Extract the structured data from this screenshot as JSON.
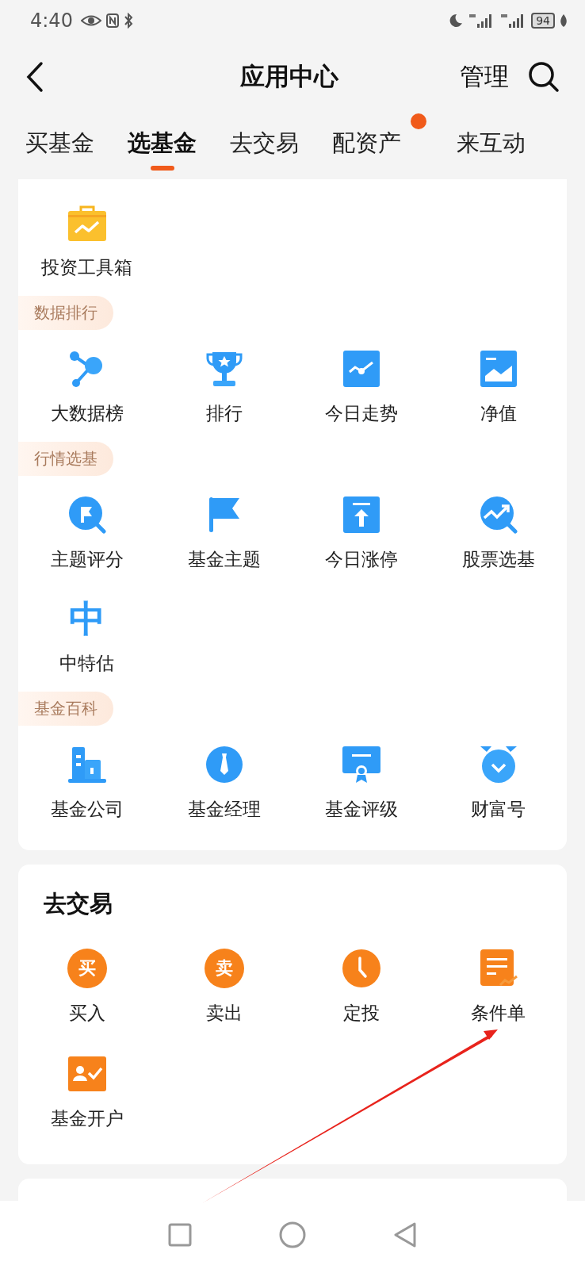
{
  "status_bar": {
    "time": "4:40",
    "battery": "94"
  },
  "header": {
    "title": "应用中心",
    "action": "管理"
  },
  "tabs": [
    {
      "label": "买基金",
      "selected": false,
      "dot": false
    },
    {
      "label": "选基金",
      "selected": true,
      "dot": false
    },
    {
      "label": "去交易",
      "selected": false,
      "dot": false
    },
    {
      "label": "配资产",
      "selected": false,
      "dot": true
    },
    {
      "label": "来互动",
      "selected": false,
      "dot": false
    }
  ],
  "select_card": {
    "sections": [
      {
        "items": [
          {
            "label": "投资工具箱"
          }
        ]
      },
      {
        "tag": "数据排行",
        "items": [
          {
            "label": "大数据榜"
          },
          {
            "label": "排行"
          },
          {
            "label": "今日走势"
          },
          {
            "label": "净值"
          }
        ]
      },
      {
        "tag": "行情选基",
        "items": [
          {
            "label": "主题评分"
          },
          {
            "label": "基金主题"
          },
          {
            "label": "今日涨停"
          },
          {
            "label": "股票选基"
          },
          {
            "label": "中特估",
            "glyph": "中"
          }
        ]
      },
      {
        "tag": "基金百科",
        "items": [
          {
            "label": "基金公司"
          },
          {
            "label": "基金经理"
          },
          {
            "label": "基金评级"
          },
          {
            "label": "财富号"
          }
        ]
      }
    ]
  },
  "trade_card": {
    "title": "去交易",
    "items": [
      {
        "label": "买入",
        "glyph": "买"
      },
      {
        "label": "卖出",
        "glyph": "卖"
      },
      {
        "label": "定投"
      },
      {
        "label": "条件单"
      },
      {
        "label": "基金开户"
      }
    ]
  }
}
